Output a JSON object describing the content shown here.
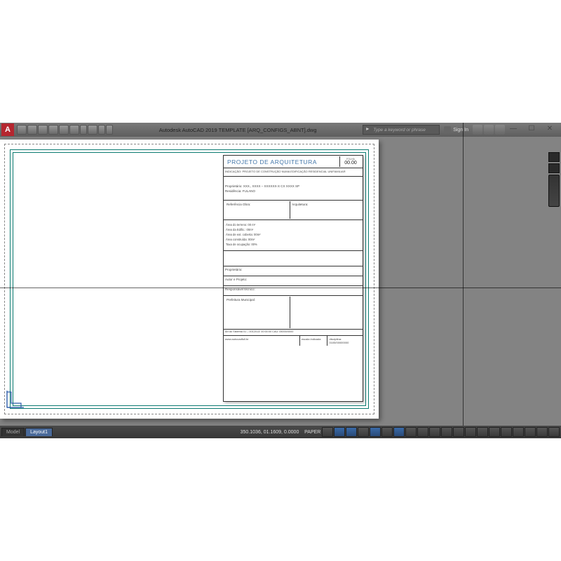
{
  "title": "Autodesk AutoCAD 2019   TEMPLATE [ARQ_CONFIGS_ABNT].dwg",
  "search": {
    "placeholder": "Type a keyword or phrase"
  },
  "signin": {
    "label": "Sign In"
  },
  "tabs": {
    "model": "Model",
    "layout": "Layout1"
  },
  "status": {
    "coords": "350.1036, 01.1609, 0.0000",
    "space": "PAPER"
  },
  "titleblock": {
    "project": "PROJETO DE ARQUITETURA",
    "sheet_label": "FOLHA",
    "sheet_num": "00.00",
    "description": "INDICAÇÃO: PROJETO DE CONSTRUÇÃO NUMA EDIFICAÇÃO RESIDENCIAL UNIFAMILIAR",
    "owner_line1": "Proprietário: XXX., XXXX – XXXXXX-X CX XXXX SP",
    "owner_line2": "Residência: FULANO",
    "ref_label": "Referência Obra:",
    "arch_label": "Arquitetura:",
    "area1": "Área do terreno: 00 m²",
    "area2": "Área da Edific.: 00m²",
    "area3": "Área de ext. coberta: 00m²",
    "area4": "Área construída: 00m²",
    "area5": "Taxa de ocupação: 00%",
    "sig1": "Proprietário:",
    "sig2": "Autor e Projeto:",
    "sig3": "Responsável técnico:",
    "pref": "Prefeitura Municipal:",
    "bottom1": "Art do Sistema 01 – 0012013: 00:00:00 CAU: 05000/0000",
    "bottom2": "www.autocadfull.br",
    "bottom3_label": "escala",
    "bottom3_val": "indicada",
    "bottom4_label": "disciplina:",
    "bottom4_val": "0105/00000000"
  }
}
